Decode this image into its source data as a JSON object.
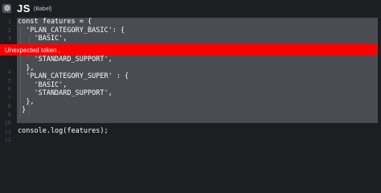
{
  "header": {
    "language": "JS",
    "sublabel": "(Babel)",
    "settings_icon": "gear-icon"
  },
  "error": {
    "message": "Unexpected token ,"
  },
  "line_numbers": [
    "1",
    "2",
    "3",
    "4",
    "5",
    "6",
    "7",
    "8",
    "9",
    "10",
    "11",
    "12"
  ],
  "code": {
    "l1": "const features = {",
    "l2": "  'PLAN_CATEGORY_BASIC': {",
    "l3": "    'BASIC',",
    "l5": "    'STANDARD_SUPPORT',",
    "l6": "  },",
    "l7": "  'PLAN_CATEGORY_SUPER' : {",
    "l8": "    'BASIC',",
    "l9": "    'STANDARD_SUPPORT',",
    "l10": "  },",
    "l11": " }",
    "l13": "console.log(features);"
  },
  "colors": {
    "background": "#1d1e22",
    "selection": "#4a4c52",
    "error": "#ff0000"
  }
}
